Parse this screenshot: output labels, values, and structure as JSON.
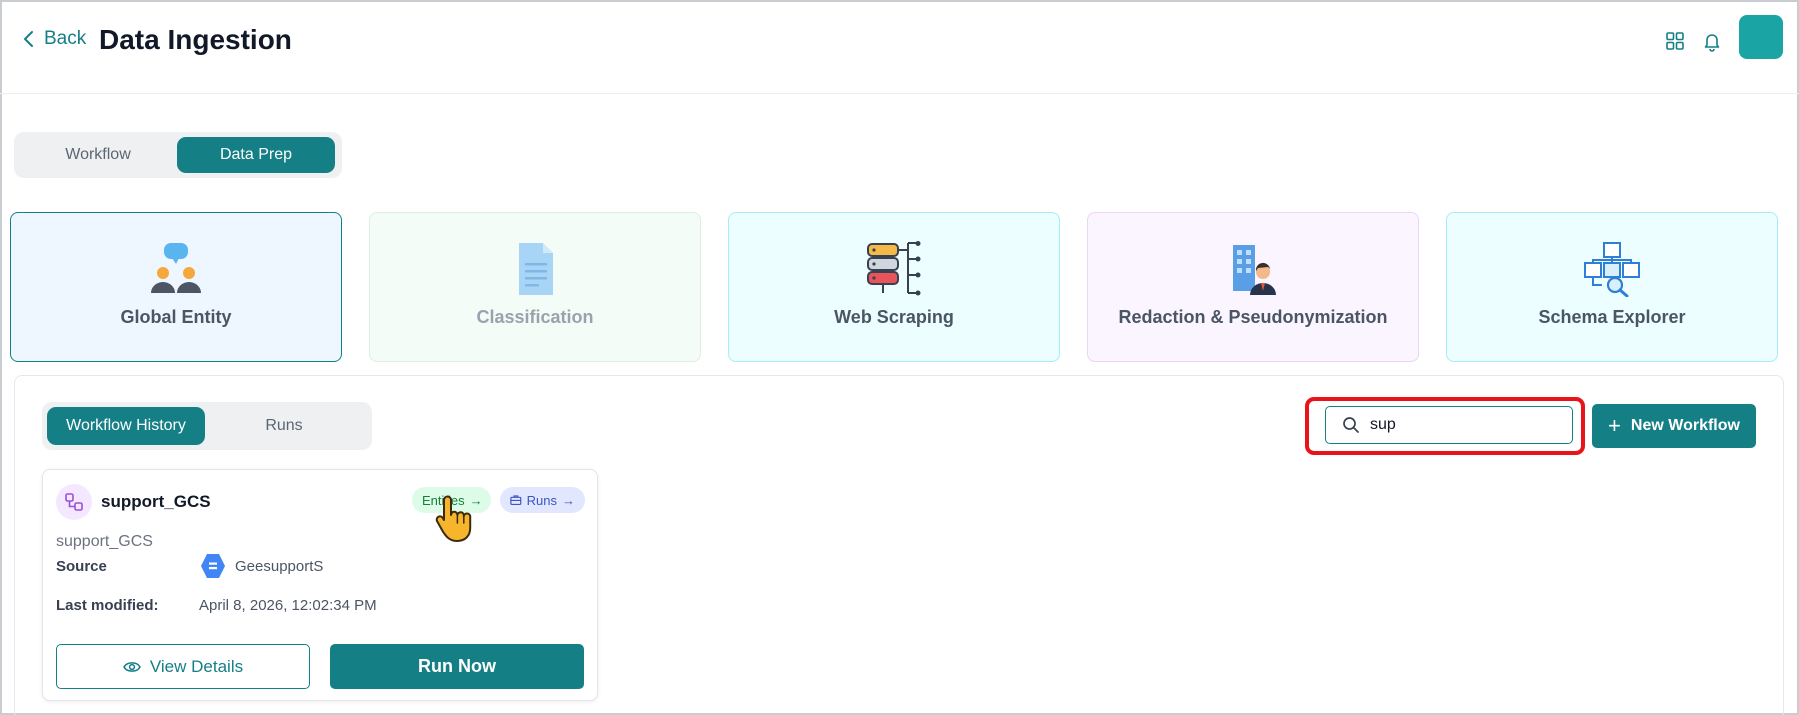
{
  "header": {
    "back_label": "Back",
    "title": "Data Ingestion",
    "icons": [
      "grid-icon",
      "bell-icon"
    ]
  },
  "mode_toggle": {
    "options": [
      "Workflow",
      "Data Prep"
    ],
    "active": "Data Prep"
  },
  "tiles": [
    {
      "label": "Global Entity",
      "icon": "people-chat-icon",
      "state": "selected",
      "bg": "#eef6ff",
      "border": "#157f86"
    },
    {
      "label": "Classification",
      "icon": "document-icon",
      "state": "disabled",
      "bg": "#f3fcf6",
      "border": "#dcefe3"
    },
    {
      "label": "Web Scraping",
      "icon": "database-network-icon",
      "state": "normal",
      "bg": "#ecfeff",
      "border": "#a5eef3"
    },
    {
      "label": "Redaction & Pseudonymization",
      "icon": "building-person-icon",
      "state": "normal",
      "bg": "#faf5ff",
      "border": "#e9d5f5"
    },
    {
      "label": "Schema Explorer",
      "icon": "schema-search-icon",
      "state": "normal",
      "bg": "#ecfeff",
      "border": "#a5eef3"
    }
  ],
  "history_toggle": {
    "options": [
      "Workflow History",
      "Runs"
    ],
    "active": "Workflow History"
  },
  "search": {
    "value": "sup",
    "placeholder": ""
  },
  "new_workflow_label": "New Workflow",
  "workflow_card": {
    "name": "support_GCS",
    "chips": {
      "entities": "Entities",
      "runs": "Runs"
    },
    "description": "support_GCS",
    "source_label": "Source",
    "source_value": "GeesupportS",
    "modified_label": "Last modified:",
    "modified_value": "April 8, 2026, 12:02:34 PM",
    "view_label": "View Details",
    "run_label": "Run Now"
  },
  "colors": {
    "primary": "#157f86",
    "highlight": "#e8141a"
  }
}
